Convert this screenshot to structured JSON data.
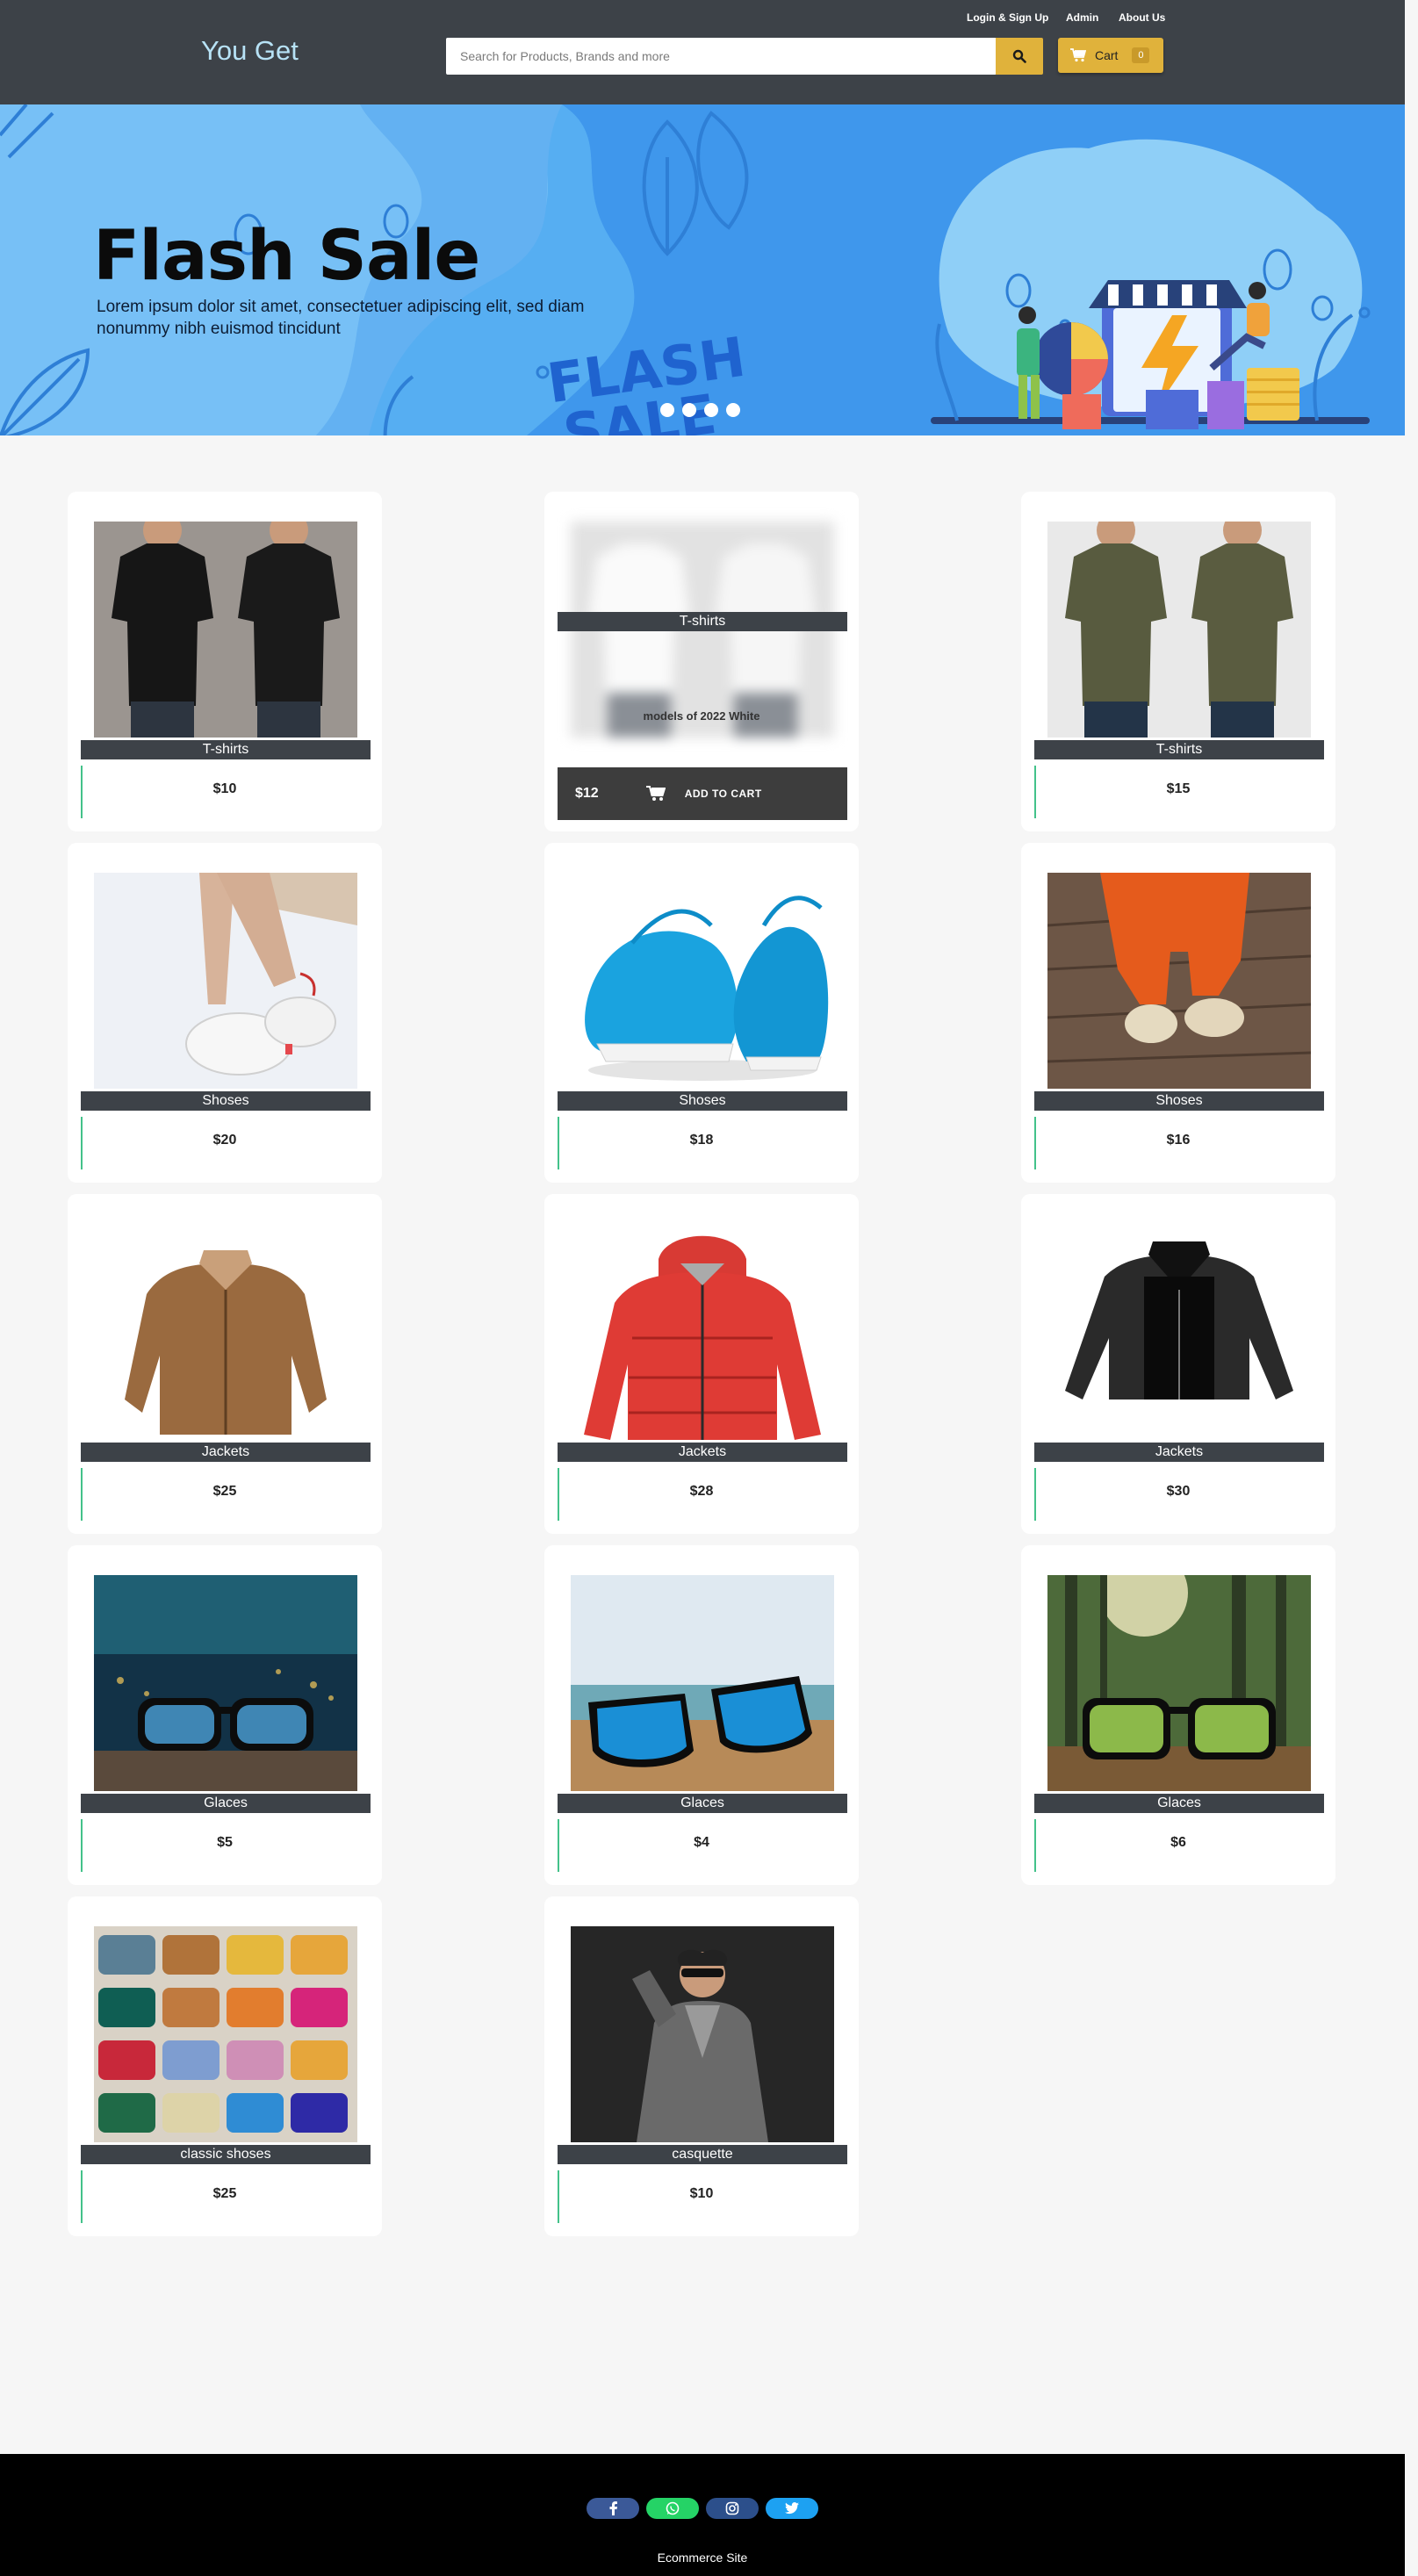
{
  "header": {
    "brand": "You Get",
    "links": [
      "Login & Sign Up",
      "Admin",
      "About Us"
    ],
    "search_placeholder": "Search for Products, Brands and more",
    "cart_label": "Cart",
    "cart_count": "0"
  },
  "banner": {
    "title": "Flash Sale",
    "subtitle": "Lorem ipsum dolor sit amet, consectetuer adipiscing elit, sed diam nonummy nibh euismod tincidunt",
    "illustration_text": "FLASH SALE",
    "slides": 4
  },
  "products": [
    {
      "category": "T-shirts",
      "price": "$10"
    },
    {
      "category": "T-shirts",
      "price": "$12",
      "description": "models of 2022 White",
      "action": "ADD TO CART"
    },
    {
      "category": "T-shirts",
      "price": "$15"
    },
    {
      "category": "Shoses",
      "price": "$20"
    },
    {
      "category": "Shoses",
      "price": "$18"
    },
    {
      "category": "Shoses",
      "price": "$16"
    },
    {
      "category": "Jackets",
      "price": "$25"
    },
    {
      "category": "Jackets",
      "price": "$28"
    },
    {
      "category": "Jackets",
      "price": "$30"
    },
    {
      "category": "Glaces",
      "price": "$5"
    },
    {
      "category": "Glaces",
      "price": "$4"
    },
    {
      "category": "Glaces",
      "price": "$6"
    },
    {
      "category": "classic shoses",
      "price": "$25"
    },
    {
      "category": "casquette",
      "price": "$10"
    }
  ],
  "footer": {
    "text": "Ecommerce Site",
    "socials": [
      "facebook-icon",
      "whatsapp-icon",
      "instagram-icon",
      "twitter-icon"
    ]
  },
  "colors": {
    "header_bg": "#3d4248",
    "accent": "#e0b23b",
    "banner_bg": "#56aef2",
    "footer_bg": "#000000"
  }
}
